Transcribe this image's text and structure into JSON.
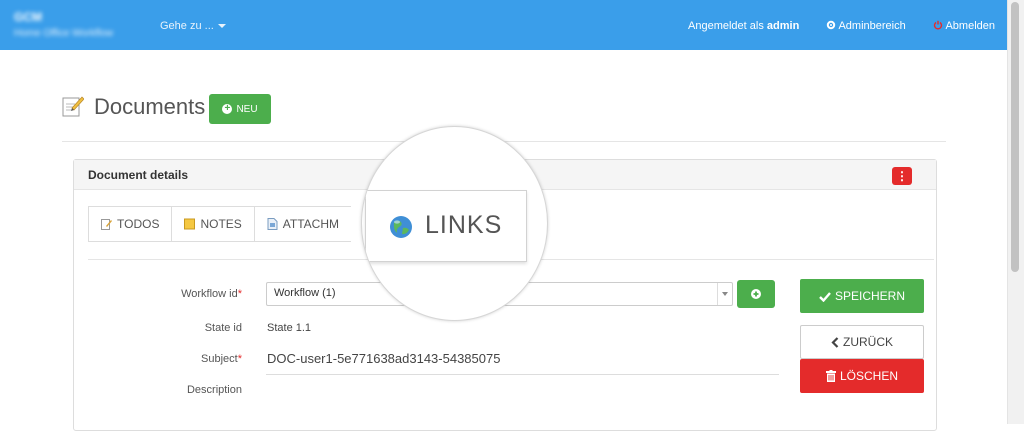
{
  "navbar": {
    "brand_line1": "GCM",
    "brand_line2": "Home Office Workflow",
    "goto_label": "Gehe zu ...",
    "logged_in_prefix": "Angemeldet als",
    "logged_in_user": "admin",
    "admin_area": "Adminbereich",
    "logout": "Abmelden"
  },
  "page": {
    "title": "Documents",
    "new_button": "NEU"
  },
  "panel": {
    "title": "Document details",
    "menu_icon": "vertical-dots-icon",
    "tabs": [
      {
        "label": "TODOS",
        "icon": "edit-icon"
      },
      {
        "label": "NOTES",
        "icon": "note-icon"
      },
      {
        "label": "ATTACHM",
        "icon": "attachment-icon"
      }
    ]
  },
  "magnifier": {
    "label": "LINKS",
    "icon": "globe-icon"
  },
  "form": {
    "workflow_label": "Workflow id",
    "workflow_value": "Workflow (1)",
    "state_label": "State id",
    "state_value": "State 1.1",
    "subject_label": "Subject",
    "subject_value": "DOC-user1-5e771638ad3143-54385075",
    "description_label": "Description",
    "required_mark": "*"
  },
  "actions": {
    "save": "SPEICHERN",
    "back": "ZURÜCK",
    "delete": "LÖSCHEN"
  },
  "colors": {
    "navbar": "#3a9eea",
    "success": "#4cae4c",
    "danger": "#e42b2b"
  }
}
